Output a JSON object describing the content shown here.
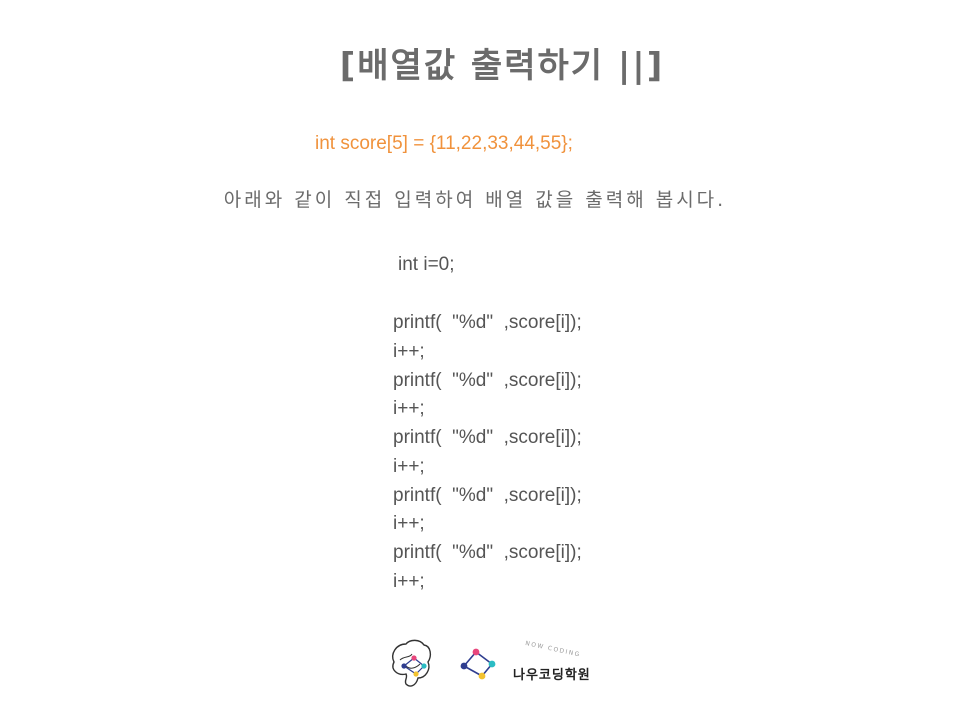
{
  "title": "[배열값 출력하기 ||]",
  "declaration": "int score[5] = {11,22,33,44,55};",
  "instruction": "아래와 같이 직접 입력하여 배열 값을 출력해 봅시다.",
  "code_init": "int i=0;",
  "code_lines": [
    "printf(  \"%d\"  ,score[i]);",
    "i++;",
    "printf(  \"%d\"  ,score[i]);",
    "i++;",
    "printf(  \"%d\"  ,score[i]);",
    "i++;",
    "printf(  \"%d\"  ,score[i]);",
    "i++;",
    "printf(  \"%d\"  ,score[i]);",
    "i++;"
  ],
  "brand": {
    "name": "나우코딩학원",
    "sub": "NOW CODING"
  },
  "colors": {
    "accent": "#f0923c",
    "text": "#6b6b6b",
    "logo_pink": "#e8467c",
    "logo_cyan": "#2bbcc4",
    "logo_yellow": "#f2c230",
    "logo_navy": "#2f3d8f"
  }
}
